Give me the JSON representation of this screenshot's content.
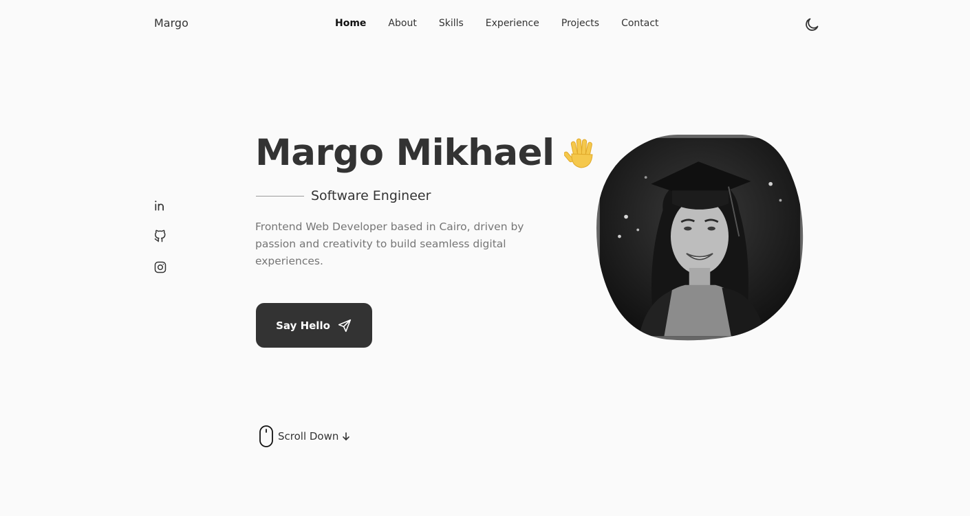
{
  "header": {
    "brand": "Margo",
    "nav": [
      "Home",
      "About",
      "Skills",
      "Experience",
      "Projects",
      "Contact"
    ],
    "active_nav": "Home",
    "theme_toggle_icon": "moon-icon"
  },
  "socials": [
    {
      "icon": "linkedin-icon"
    },
    {
      "icon": "github-icon"
    },
    {
      "icon": "instagram-icon"
    }
  ],
  "hero": {
    "name": "Margo Mikhael",
    "wave_icon": "waving-hand-icon",
    "subtitle": "Software Engineer",
    "description": "Frontend Web Developer based in Cairo, driven by passion and creativity to build seamless digital experiences.",
    "cta_label": "Say Hello",
    "cta_icon": "send-icon",
    "scroll_label": "Scroll Down",
    "scroll_icons": [
      "mouse-icon",
      "arrow-down-icon"
    ],
    "image": "profile-photo-grayscale-graduation-cap"
  },
  "colors": {
    "background": "#fafafa",
    "text": "#333333",
    "muted_text": "#757575",
    "button_bg": "#333333",
    "button_text": "#ffffff",
    "blob_border": "#666666",
    "wave_hand": "#f2c94c"
  }
}
